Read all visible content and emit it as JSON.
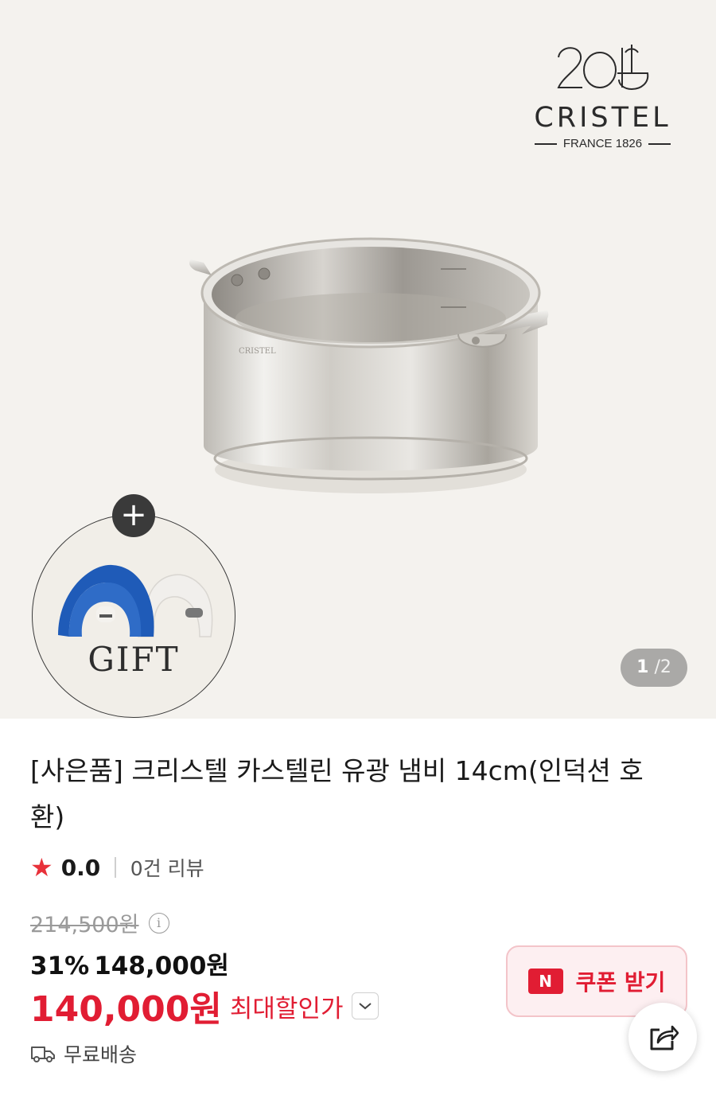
{
  "hero": {
    "brand": {
      "name": "CRISTEL",
      "subtitle": "FRANCE 1826"
    },
    "gift": {
      "label": "GIFT",
      "plus": "+"
    },
    "pager": {
      "current": "1",
      "total": "2",
      "separator": "/"
    }
  },
  "product": {
    "title": "[사은품] 크리스텔 카스텔린 유광 냄비 14cm(인덕션 호환)",
    "rating": {
      "score": "0.0",
      "reviews": "0건 리뷰"
    },
    "original_price": "214,500원",
    "discount": {
      "percent": "31%",
      "price": "148,000원"
    },
    "max_discount": {
      "price": "140,000원",
      "label": "최대할인가"
    },
    "coupon": {
      "badge": "N",
      "label": "쿠폰 받기"
    },
    "shipping": {
      "label": "무료배송"
    }
  },
  "colors": {
    "accent_red": "#e11d33",
    "background": "#f4f2ee"
  },
  "icons": [
    "star-icon",
    "info-icon",
    "chevron-down-icon",
    "share-icon",
    "truck-icon",
    "plus-icon"
  ]
}
